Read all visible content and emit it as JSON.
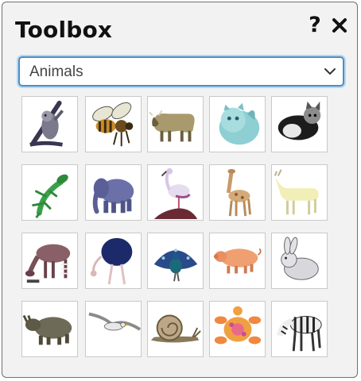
{
  "toolbox": {
    "title": "Toolbox",
    "help_label": "?",
    "close_icon": "close-icon"
  },
  "category_select": {
    "selected": "Animals"
  },
  "animals": [
    {
      "name": "sloth"
    },
    {
      "name": "bee"
    },
    {
      "name": "bull"
    },
    {
      "name": "persian-cat"
    },
    {
      "name": "cat"
    },
    {
      "name": "lizard"
    },
    {
      "name": "elephant"
    },
    {
      "name": "flamingo"
    },
    {
      "name": "giraffe"
    },
    {
      "name": "goat"
    },
    {
      "name": "okapi"
    },
    {
      "name": "ostrich"
    },
    {
      "name": "peacock"
    },
    {
      "name": "pig"
    },
    {
      "name": "rabbit"
    },
    {
      "name": "rhinoceros"
    },
    {
      "name": "seagull"
    },
    {
      "name": "snail"
    },
    {
      "name": "sea-turtle"
    },
    {
      "name": "zebra"
    }
  ]
}
